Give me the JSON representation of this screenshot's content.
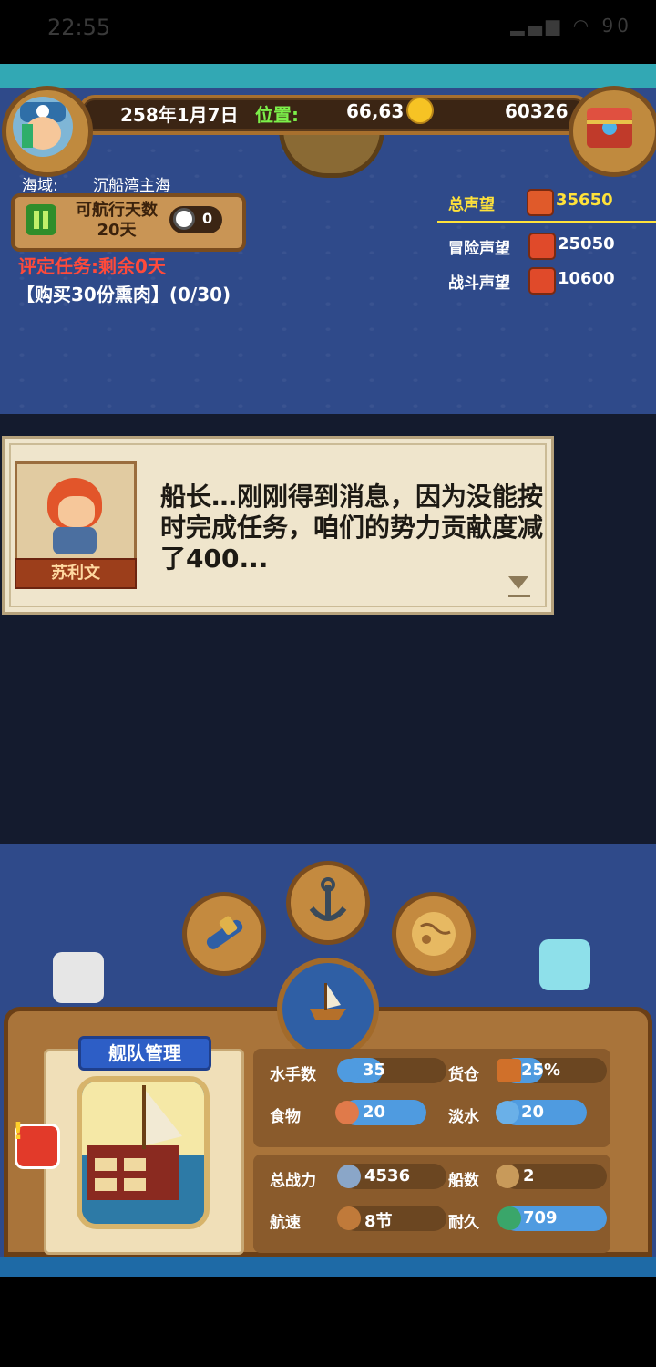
{
  "status": {
    "time": "22:55",
    "battery": "90"
  },
  "top": {
    "date": "258年1月7日",
    "position_label": "位置:",
    "position_value": "66,63",
    "gold": "60326",
    "sea_label": "海域:",
    "sea_name": "沉船湾主海",
    "days_label": "可航行天数",
    "days_value": "20天",
    "wheel_value": "0",
    "task_status": "评定任务:剩余0天",
    "task_desc": "【购买30份熏肉】(0/30)"
  },
  "reputation": [
    {
      "label": "总声望",
      "value": "35650",
      "color": "#e05a2a"
    },
    {
      "label": "冒险声望",
      "value": "25050",
      "color": "#e04a2a"
    },
    {
      "label": "战斗声望",
      "value": "10600",
      "color": "#e04a2a"
    }
  ],
  "dialog": {
    "speaker": "苏利文",
    "text": "船长…刚刚得到消息，因为没能按时完成任务，咱们的势力贡献度减了400..."
  },
  "fleet": {
    "title": "舰队管理",
    "stats": [
      {
        "label": "水手数",
        "value": "35",
        "fill": 0.12
      },
      {
        "label": "货仓",
        "value": "25%",
        "fill": 0.25
      },
      {
        "label": "食物",
        "value": "20",
        "fill": 0.88
      },
      {
        "label": "淡水",
        "value": "20",
        "fill": 0.88
      },
      {
        "label": "总战力",
        "value": "4536",
        "fill": 0.0
      },
      {
        "label": "船数",
        "value": "2",
        "fill": 0.0
      },
      {
        "label": "航速",
        "value": "8节",
        "fill": 0.0
      },
      {
        "label": "耐久",
        "value": "709",
        "fill": 1.0
      }
    ]
  },
  "icons": {
    "telescope": "telescope-icon",
    "anchor": "anchor-icon",
    "map": "map-icon",
    "ship": "ship-icon"
  }
}
